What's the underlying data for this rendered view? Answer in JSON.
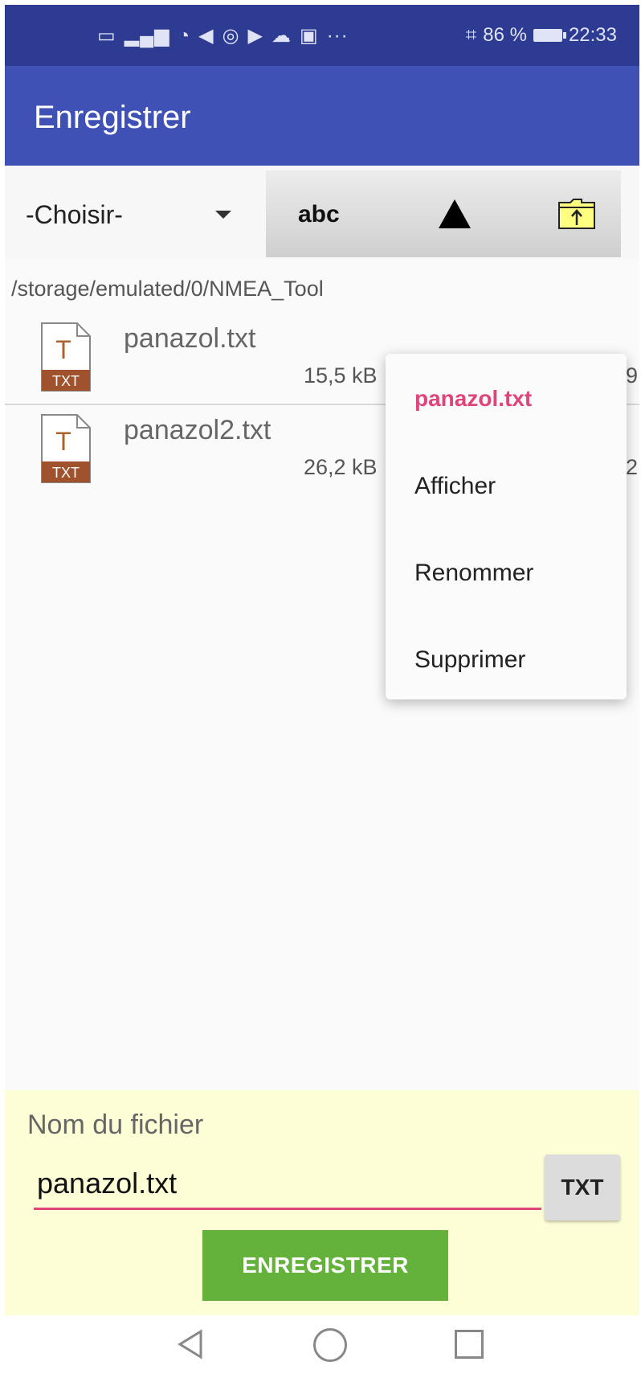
{
  "status_bar": {
    "left_icons": [
      "wifi-calling-icon",
      "signal-icon",
      "wifi-icon",
      "navigation-icon",
      "alarm-icon",
      "play-icon",
      "cloud-icon",
      "gallery-icon"
    ],
    "more": "···",
    "battery_percent": "86 %",
    "time": "22:33"
  },
  "app_bar": {
    "title": "Enregistrer"
  },
  "toolbar": {
    "spinner_value": "-Choisir-",
    "sort_label": "abc",
    "sort_icon": "triangle-up-icon",
    "folder_icon": "folder-up-icon"
  },
  "path": "/storage/emulated/0/NMEA_Tool",
  "files": [
    {
      "name": "panazol.txt",
      "size": "15,5 kB",
      "tail": "9",
      "type": "TXT"
    },
    {
      "name": "panazol2.txt",
      "size": "26,2 kB",
      "tail": "2",
      "type": "TXT"
    }
  ],
  "context_menu": {
    "title": "panazol.txt",
    "items": [
      "Afficher",
      "Renommer",
      "Supprimer"
    ]
  },
  "bottom": {
    "label": "Nom du fichier",
    "filename_value": "panazol.txt",
    "ext_button": "TXT",
    "save_button": "ENREGISTRER"
  },
  "colors": {
    "app_bar": "#3f51b5",
    "status_bar": "#2e3b93",
    "accent": "#e0447a",
    "save_button": "#64b23b",
    "bottom_panel": "#fdfdd6"
  }
}
